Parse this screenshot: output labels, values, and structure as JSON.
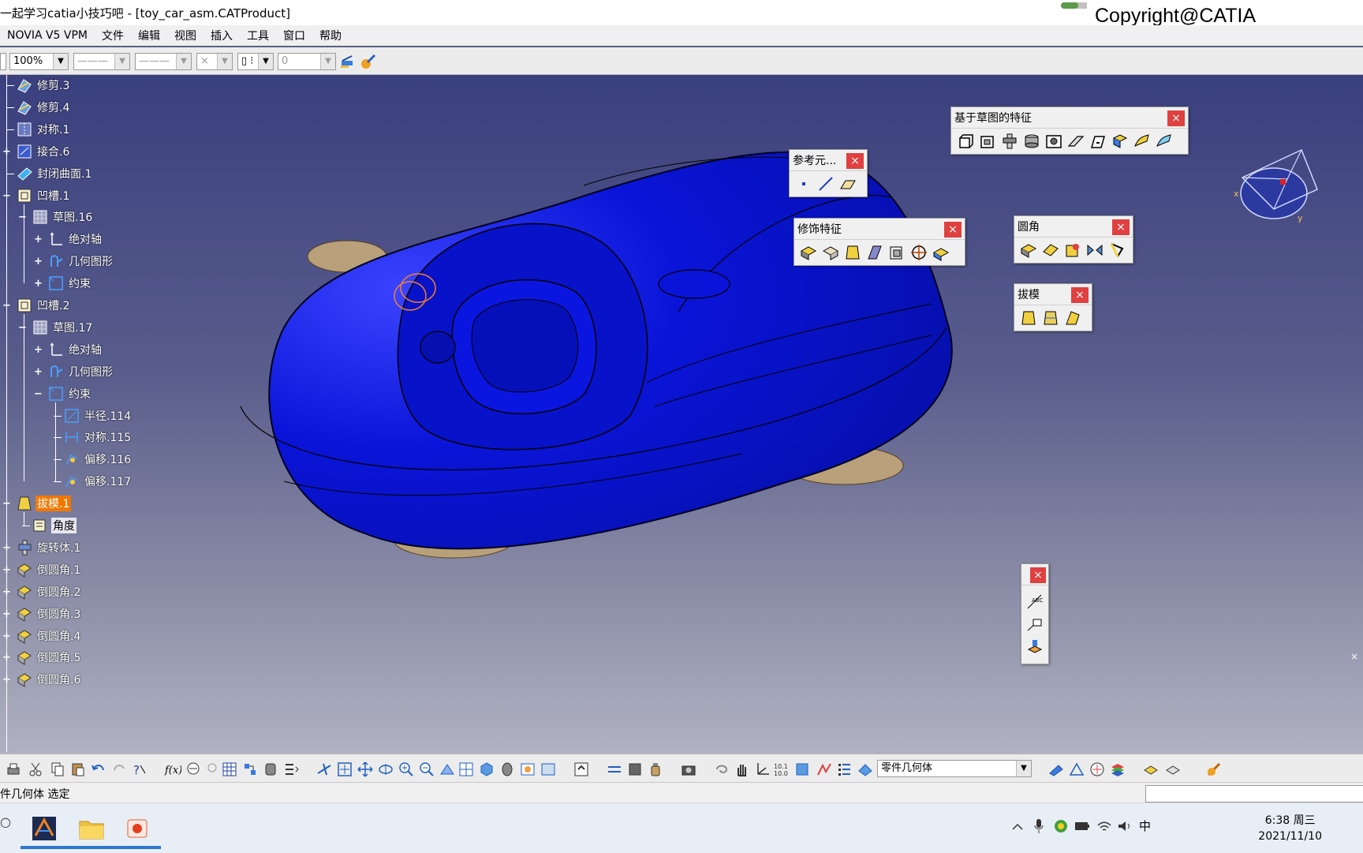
{
  "window": {
    "title": "一起学习catia小技巧吧 - [toy_car_asm.CATProduct]",
    "copyright": "Copyright@CATIA"
  },
  "menu": [
    "NOVIA V5 VPM",
    "文件",
    "编辑",
    "视图",
    "插入",
    "工具",
    "窗口",
    "帮助"
  ],
  "toolbar": {
    "zoom": "100%",
    "line_type_1": "———",
    "line_type_2": "———",
    "cross": "×",
    "layer_value": "0"
  },
  "tree": [
    {
      "label": "修剪.3",
      "level": 0,
      "icon": "trim-surface-icon"
    },
    {
      "label": "修剪.4",
      "level": 0,
      "icon": "trim-surface-icon"
    },
    {
      "label": "对称.1",
      "level": 0,
      "icon": "symmetry-icon"
    },
    {
      "label": "接合.6",
      "level": 0,
      "icon": "join-icon",
      "expand": "+"
    },
    {
      "label": "封闭曲面.1",
      "level": 0,
      "icon": "close-surface-icon"
    },
    {
      "label": "凹槽.1",
      "level": 0,
      "icon": "pocket-icon",
      "expand": "-"
    },
    {
      "label": "草图.16",
      "level": 1,
      "icon": "sketch-icon",
      "expand": "-"
    },
    {
      "label": "绝对轴",
      "level": 2,
      "icon": "absolute-axis-icon",
      "expand": "+"
    },
    {
      "label": "几何图形",
      "level": 2,
      "icon": "geometry-icon",
      "expand": "+"
    },
    {
      "label": "约束",
      "level": 2,
      "icon": "constraint-icon",
      "expand": "+"
    },
    {
      "label": "凹槽.2",
      "level": 0,
      "icon": "pocket-icon",
      "expand": "-"
    },
    {
      "label": "草图.17",
      "level": 1,
      "icon": "sketch-icon",
      "expand": "-"
    },
    {
      "label": "绝对轴",
      "level": 2,
      "icon": "absolute-axis-icon",
      "expand": "+"
    },
    {
      "label": "几何图形",
      "level": 2,
      "icon": "geometry-icon",
      "expand": "+"
    },
    {
      "label": "约束",
      "level": 2,
      "icon": "constraint-icon",
      "expand": "-"
    },
    {
      "label": "半径.114",
      "level": 3,
      "icon": "radius-icon"
    },
    {
      "label": "对称.115",
      "level": 3,
      "icon": "symmetry-constraint-icon"
    },
    {
      "label": "偏移.116",
      "level": 3,
      "icon": "offset-icon"
    },
    {
      "label": "偏移.117",
      "level": 3,
      "icon": "offset-icon"
    },
    {
      "label": "拔模.1",
      "level": 0,
      "icon": "draft-icon",
      "expand": "-",
      "highlight": true
    },
    {
      "label": "角度",
      "level": 1,
      "icon": "angle-icon",
      "dark": true
    },
    {
      "label": "旋转体.1",
      "level": 0,
      "icon": "revolve-icon",
      "expand": "+"
    },
    {
      "label": "倒圆角.1",
      "level": 0,
      "icon": "fillet-icon",
      "expand": "+"
    },
    {
      "label": "倒圆角.2",
      "level": 0,
      "icon": "fillet-icon",
      "expand": "+"
    },
    {
      "label": "倒圆角.3",
      "level": 0,
      "icon": "fillet-icon",
      "expand": "+"
    },
    {
      "label": "倒圆角.4",
      "level": 0,
      "icon": "fillet-icon",
      "expand": "+"
    },
    {
      "label": "倒圆角.5",
      "level": 0,
      "icon": "fillet-icon",
      "expand": "+"
    },
    {
      "label": "倒圆角.6",
      "level": 0,
      "icon": "fillet-icon",
      "expand": "+"
    }
  ],
  "floating_toolbars": {
    "sketch_based": {
      "title": "基于草图的特征",
      "close": "×"
    },
    "reference": {
      "title": "参考元...",
      "close": "×"
    },
    "dress_up": {
      "title": "修饰特征",
      "close": "×"
    },
    "fillet": {
      "title": "圆角",
      "close": "×"
    },
    "draft": {
      "title": "拔模",
      "close": "×"
    },
    "small": {
      "title": "",
      "close": "×"
    }
  },
  "bottom": {
    "body_select": "零件几何体",
    "status": "件几何体 选定"
  },
  "taskbar": {
    "time": "6:38 周三",
    "date": "2021/11/10",
    "ime": "中"
  },
  "colors": {
    "car_body": "#0a14d8",
    "highlight": "#f07800",
    "close_button": "#e04040"
  }
}
